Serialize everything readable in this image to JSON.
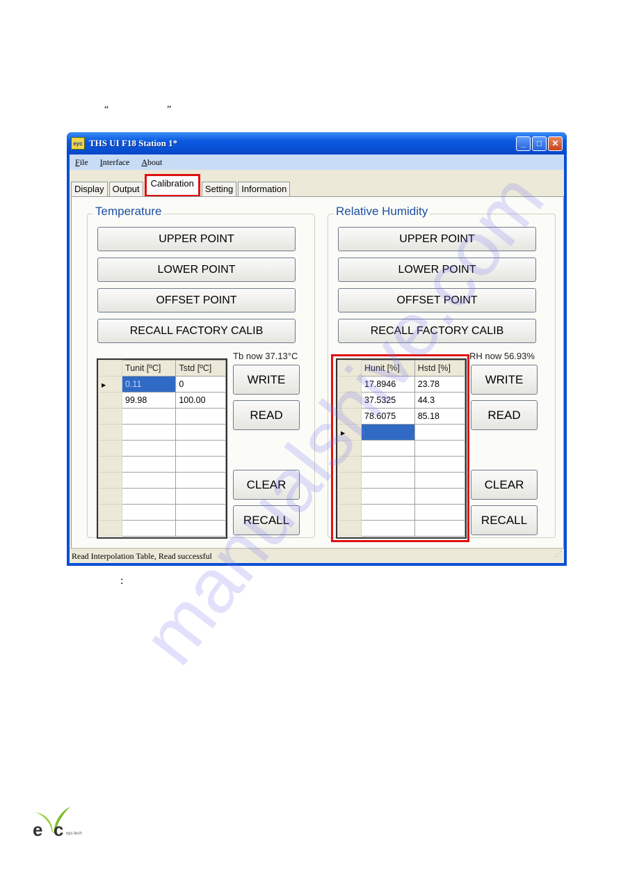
{
  "doc": {
    "open_quote": "“",
    "close_quote": "”",
    "colon": ":",
    "watermark": "manualshive.com",
    "logo_text": "eyc-tech"
  },
  "window": {
    "title": "THS UI F18  Station 1*",
    "app_icon_text": "eyc",
    "menu": [
      {
        "label": "File",
        "mnemonic": "F",
        "rest": "ile"
      },
      {
        "label": "Interface",
        "mnemonic": "I",
        "rest": "nterface"
      },
      {
        "label": "About",
        "mnemonic": "A",
        "rest": "bout"
      }
    ],
    "tabs": [
      "Display",
      "Output",
      "Calibration",
      "Setting",
      "Information"
    ],
    "active_tab": "Calibration",
    "status": "Read Interpolation Table,  Read successful"
  },
  "temperature": {
    "title": "Temperature",
    "buttons": [
      "UPPER POINT",
      "LOWER POINT",
      "OFFSET POINT",
      "RECALL FACTORY CALIB"
    ],
    "now": "Tb now 37.13°C",
    "columns": [
      "Tunit [ºC]",
      "Tstd [ºC]"
    ],
    "rows": [
      [
        "0.11",
        "0"
      ],
      [
        "99.98",
        "100.00"
      ],
      [
        "",
        ""
      ],
      [
        "",
        ""
      ],
      [
        "",
        ""
      ],
      [
        "",
        ""
      ],
      [
        "",
        ""
      ],
      [
        "",
        ""
      ],
      [
        "",
        ""
      ],
      [
        "",
        ""
      ]
    ],
    "side_buttons": {
      "write": "WRITE",
      "read": "READ",
      "clear": "CLEAR",
      "recall": "RECALL"
    }
  },
  "humidity": {
    "title": "Relative Humidity",
    "buttons": [
      "UPPER POINT",
      "LOWER POINT",
      "OFFSET POINT",
      "RECALL FACTORY CALIB"
    ],
    "now": "RH now 56.93%",
    "columns": [
      "Hunit [%]",
      "Hstd [%]"
    ],
    "rows": [
      [
        "17.8946",
        "23.78"
      ],
      [
        "37.5325",
        "44.3"
      ],
      [
        "78.6075",
        "85.18"
      ],
      [
        "",
        ""
      ],
      [
        "",
        ""
      ],
      [
        "",
        ""
      ],
      [
        "",
        ""
      ],
      [
        "",
        ""
      ],
      [
        "",
        ""
      ],
      [
        "",
        ""
      ]
    ],
    "side_buttons": {
      "write": "WRITE",
      "read": "READ",
      "clear": "CLEAR",
      "recall": "RECALL"
    }
  },
  "colors": {
    "highlight": "#e0120f",
    "selection": "#316ac5",
    "group_title": "#1d4fa0"
  }
}
